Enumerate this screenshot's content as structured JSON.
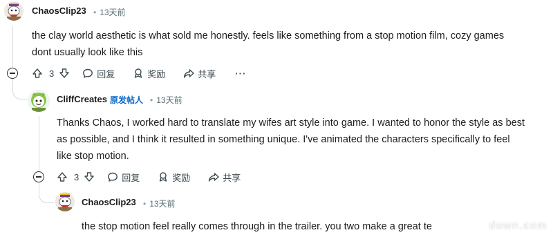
{
  "comments": [
    {
      "username": "ChaosClip23",
      "separator": "•",
      "time": "13天前",
      "lines": [
        "the clay world aesthetic is what sold me honestly. feels like something from a stop motion film, cozy games",
        "dont usually look like this"
      ],
      "votes": "3",
      "reply_label": "回复",
      "award_label": "奖励",
      "share_label": "共享",
      "more_label": "···"
    },
    {
      "username": "CliffCreates",
      "op_badge": "原发帖人",
      "separator": "•",
      "time": "13天前",
      "lines": [
        "Thanks Chaos, I worked hard to translate my wifes art style into game. I wanted to honor the style as best",
        "as possible, and I think it resulted in something unique. I've animated the characters specifically to feel",
        "like stop motion."
      ],
      "votes": "3",
      "reply_label": "回复",
      "award_label": "奖励",
      "share_label": "共享"
    },
    {
      "username": "ChaosClip23",
      "separator": "•",
      "time": "13天前",
      "lines": [
        "the stop motion feel really comes through in the trailer. you two make a great te"
      ]
    }
  ],
  "watermark": "down.com",
  "colors": {
    "text": "#1c1c1c",
    "meta": "#576f76",
    "op_badge": "#0a66c2",
    "thread_line": "#d4dadc"
  }
}
